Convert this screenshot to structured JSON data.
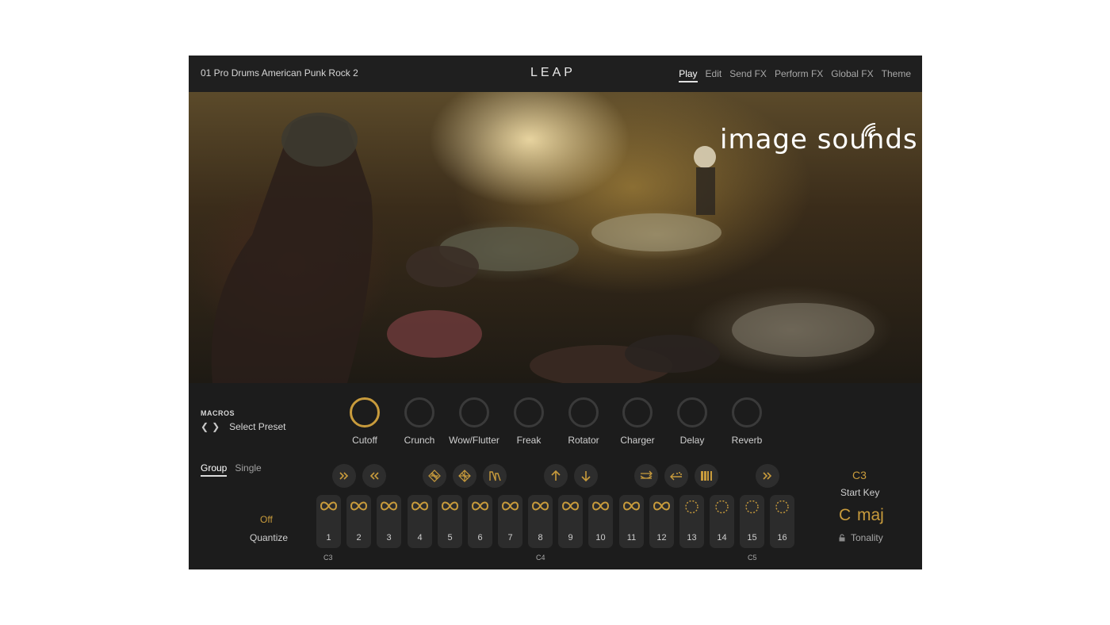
{
  "header": {
    "preset_name": "01 Pro Drums American Punk Rock 2",
    "logo": "LEAP",
    "tabs": [
      "Play",
      "Edit",
      "Send FX",
      "Perform FX",
      "Global FX",
      "Theme"
    ],
    "active_tab": "Play"
  },
  "hero": {
    "brand": "image sounds"
  },
  "macros": {
    "title": "MACROS",
    "prev_icon": "chevron-left-icon",
    "next_icon": "chevron-right-icon",
    "select_preset": "Select Preset",
    "knobs": [
      {
        "label": "Cutoff",
        "active": true
      },
      {
        "label": "Crunch",
        "active": false
      },
      {
        "label": "Wow/Flutter",
        "active": false
      },
      {
        "label": "Freak",
        "active": false
      },
      {
        "label": "Rotator",
        "active": false
      },
      {
        "label": "Charger",
        "active": false
      },
      {
        "label": "Delay",
        "active": false
      },
      {
        "label": "Reverb",
        "active": false
      }
    ]
  },
  "mode": {
    "options": [
      "Group",
      "Single"
    ],
    "active": "Group"
  },
  "actions": [
    "fast-forward-icon",
    "rewind-icon",
    "grid-a-icon",
    "grid-b-icon",
    "wave-icon",
    "arrow-up-icon",
    "arrow-down-icon",
    "swap-icon",
    "scatter-icon",
    "bars-icon",
    "forward-icon"
  ],
  "quantize": {
    "value": "Off",
    "label": "Quantize"
  },
  "pads": [
    {
      "num": "1",
      "icon": "loop-icon"
    },
    {
      "num": "2",
      "icon": "loop-icon"
    },
    {
      "num": "3",
      "icon": "loop-icon"
    },
    {
      "num": "4",
      "icon": "loop-icon"
    },
    {
      "num": "5",
      "icon": "loop-icon"
    },
    {
      "num": "6",
      "icon": "loop-icon"
    },
    {
      "num": "7",
      "icon": "loop-icon"
    },
    {
      "num": "8",
      "icon": "loop-icon"
    },
    {
      "num": "9",
      "icon": "loop-icon"
    },
    {
      "num": "10",
      "icon": "loop-icon"
    },
    {
      "num": "11",
      "icon": "loop-icon"
    },
    {
      "num": "12",
      "icon": "loop-icon"
    },
    {
      "num": "13",
      "icon": "one-shot-icon"
    },
    {
      "num": "14",
      "icon": "one-shot-icon"
    },
    {
      "num": "15",
      "icon": "one-shot-icon"
    },
    {
      "num": "16",
      "icon": "one-shot-icon"
    }
  ],
  "note_labels": [
    "C3",
    "C4",
    "C5"
  ],
  "start_key": {
    "value": "C3",
    "label": "Start Key"
  },
  "tonality": {
    "root": "C",
    "scale": "maj",
    "label": "Tonality",
    "lock_icon": "lock-icon"
  },
  "colors": {
    "accent": "#c89b3c",
    "panel": "#1c1c1c",
    "pad": "#2c2c2c"
  }
}
